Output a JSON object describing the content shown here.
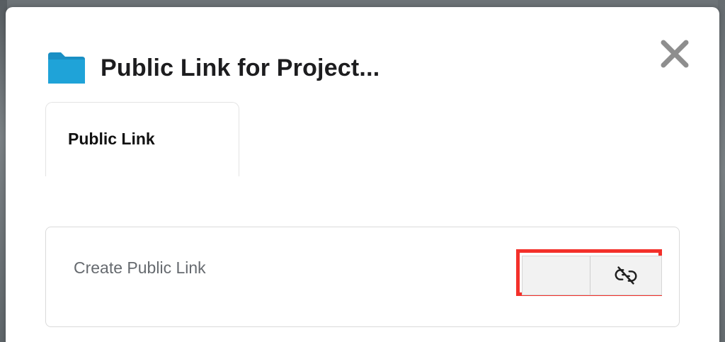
{
  "dialog": {
    "title": "Public Link for Project...",
    "folder_icon": "folder-icon",
    "folder_color": "#1fa3d8",
    "close_icon": "close-icon"
  },
  "tabs": [
    {
      "label": "Public Link",
      "active": true
    }
  ],
  "panel": {
    "label": "Create Public Link",
    "toggle_icon": "unlink-icon",
    "highlight_color": "#f3302a"
  }
}
